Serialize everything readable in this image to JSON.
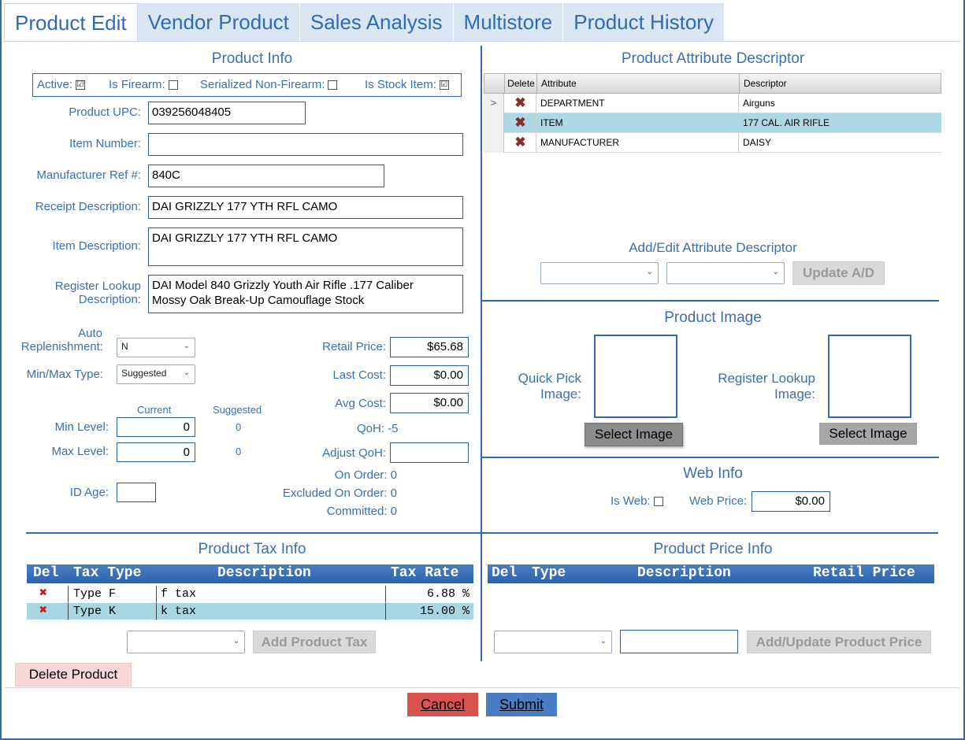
{
  "tabs": [
    "Product Edit",
    "Vendor Product",
    "Sales Analysis",
    "Multistore",
    "Product History"
  ],
  "product_info": {
    "title": "Product Info",
    "flags": {
      "active_label": "Active:",
      "active_checked": "☑",
      "firearm_label": "Is Firearm:",
      "serialized_label": "Serialized Non-Firearm:",
      "stock_label": "Is Stock Item:",
      "stock_checked": "☑"
    },
    "upc_label": "Product UPC:",
    "upc_value": "039256048405",
    "item_number_label": "Item Number:",
    "item_number_value": "",
    "mfr_ref_label": "Manufacturer Ref #:",
    "mfr_ref_value": "840C",
    "receipt_desc_label": "Receipt Description:",
    "receipt_desc_value": "DAI GRIZZLY 177 YTH RFL CAMO",
    "item_desc_label": "Item Description:",
    "item_desc_value": "DAI GRIZZLY 177 YTH RFL CAMO",
    "register_lookup_label_1": "Register Lookup",
    "register_lookup_label_2": "Description:",
    "register_lookup_line1": "DAI Model 840 Grizzly Youth Air Rifle .177 Caliber",
    "register_lookup_line2": "Mossy Oak Break-Up Camouflage Stock",
    "auto_replenish_label_1": "Auto",
    "auto_replenish_label_2": "Replenishment:",
    "auto_replenish_value": "N",
    "minmax_type_label": "Min/Max Type:",
    "minmax_type_value": "Suggested",
    "current_header": "Current",
    "suggested_header": "Suggested",
    "min_level_label": "Min Level:",
    "min_level_current": "0",
    "min_level_suggested": "0",
    "max_level_label": "Max Level:",
    "max_level_current": "0",
    "max_level_suggested": "0",
    "id_age_label": "ID Age:",
    "id_age_value": "",
    "retail_price_label": "Retail Price:",
    "retail_price_value": "$65.68",
    "last_cost_label": "Last Cost:",
    "last_cost_value": "$0.00",
    "avg_cost_label": "Avg Cost:",
    "avg_cost_value": "$0.00",
    "qoh_text": "QoH: -5",
    "adjust_qoh_label": "Adjust QoH:",
    "adjust_qoh_value": "",
    "on_order_text": "On Order: 0",
    "excluded_on_order_text": "Excluded On Order: 0",
    "committed_text": "Committed: 0"
  },
  "attributes": {
    "title": "Product Attribute Descriptor",
    "headers": {
      "delete": "Delete",
      "attribute": "Attribute",
      "descriptor": "Descriptor"
    },
    "rows": [
      {
        "attribute": "DEPARTMENT",
        "descriptor": "Airguns"
      },
      {
        "attribute": "ITEM",
        "descriptor": "177 CAL. AIR RIFLE"
      },
      {
        "attribute": "MANUFACTURER",
        "descriptor": "DAISY"
      }
    ],
    "row_pointer": ">",
    "edit_title": "Add/Edit Attribute Descriptor",
    "update_button": "Update A/D"
  },
  "image": {
    "title": "Product Image",
    "quick_pick_label_1": "Quick Pick",
    "quick_pick_label_2": "Image:",
    "register_lookup_label_1": "Register Lookup",
    "register_lookup_label_2": "Image:",
    "select_image_button": "Select Image"
  },
  "web": {
    "title": "Web Info",
    "is_web_label": "Is Web:",
    "web_price_label": "Web Price:",
    "web_price_value": "$0.00"
  },
  "tax": {
    "title": "Product Tax Info",
    "headers": {
      "del": "Del",
      "type": "Tax Type",
      "description": "Description",
      "rate": "Tax Rate"
    },
    "rows": [
      {
        "type": "Type F",
        "description": "f tax",
        "rate": "6.88 %"
      },
      {
        "type": "Type K",
        "description": "k tax",
        "rate": "15.00 %"
      }
    ],
    "add_button": "Add Product Tax"
  },
  "price": {
    "title": "Product Price Info",
    "headers": {
      "del": "Del",
      "type": "Type",
      "description": "Description",
      "retail": "Retail Price"
    },
    "add_button": "Add/Update Product Price"
  },
  "footer": {
    "delete_button": "Delete Product",
    "cancel_button": "Cancel",
    "submit_button": "Submit"
  },
  "colors": {
    "accent": "#2f6bb5",
    "cancel": "#d9534f",
    "submit": "#4a7ec4",
    "delete_bg": "#f8d7d7"
  }
}
